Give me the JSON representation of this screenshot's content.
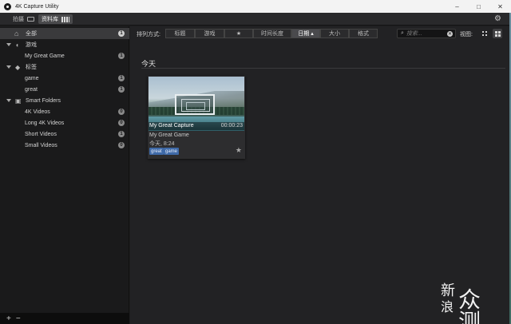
{
  "window": {
    "title": "4K Capture Utility",
    "controls": [
      "–",
      "□",
      "✕"
    ]
  },
  "modes": {
    "capture": "拍摄",
    "library": "资料库"
  },
  "sidebar": {
    "all": {
      "label": "全部",
      "count": "1"
    },
    "games": {
      "label": "游戏",
      "items": [
        {
          "label": "My Great Game",
          "count": "1"
        }
      ]
    },
    "tags": {
      "label": "标签",
      "items": [
        {
          "label": "game",
          "count": "1"
        },
        {
          "label": "great",
          "count": "1"
        }
      ]
    },
    "smart": {
      "label": "Smart Folders",
      "items": [
        {
          "label": "4K Videos",
          "count": "0"
        },
        {
          "label": "Long 4K Videos",
          "count": "0"
        },
        {
          "label": "Short Videos",
          "count": "1"
        },
        {
          "label": "Small Videos",
          "count": "0"
        }
      ]
    },
    "footer": {
      "add": "+",
      "remove": "−"
    }
  },
  "sortbar": {
    "label": "排列方式:",
    "options": [
      "标题",
      "游戏",
      "★",
      "时间长度",
      "日期 ▴",
      "大小",
      "格式"
    ],
    "active_index": 4
  },
  "search": {
    "placeholder": "搜索..."
  },
  "view": {
    "label": "视图:"
  },
  "section": {
    "title": "今天"
  },
  "card": {
    "title": "My Great Capture",
    "duration": "00:00:23",
    "game": "My Great Game",
    "date": "今天, 8:24",
    "tags": [
      "great",
      "game"
    ]
  },
  "watermark": {
    "line1": "新",
    "line2": "浪",
    "big": "众测"
  },
  "colors": {
    "accent_tag": "#3f6aa8",
    "background": "#1e1e1f",
    "sidebar": "#1a1a1b"
  }
}
